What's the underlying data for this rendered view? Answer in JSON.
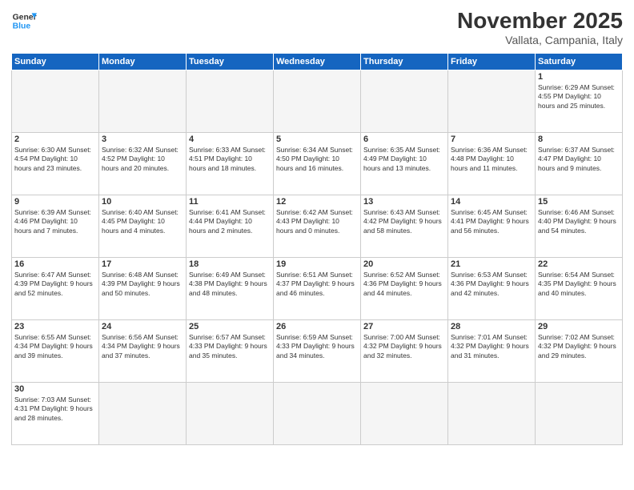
{
  "header": {
    "logo_general": "General",
    "logo_blue": "Blue",
    "month_title": "November 2025",
    "subtitle": "Vallata, Campania, Italy"
  },
  "days_of_week": [
    "Sunday",
    "Monday",
    "Tuesday",
    "Wednesday",
    "Thursday",
    "Friday",
    "Saturday"
  ],
  "weeks": [
    [
      {
        "num": "",
        "info": ""
      },
      {
        "num": "",
        "info": ""
      },
      {
        "num": "",
        "info": ""
      },
      {
        "num": "",
        "info": ""
      },
      {
        "num": "",
        "info": ""
      },
      {
        "num": "",
        "info": ""
      },
      {
        "num": "1",
        "info": "Sunrise: 6:29 AM\nSunset: 4:55 PM\nDaylight: 10 hours and 25 minutes."
      }
    ],
    [
      {
        "num": "2",
        "info": "Sunrise: 6:30 AM\nSunset: 4:54 PM\nDaylight: 10 hours and 23 minutes."
      },
      {
        "num": "3",
        "info": "Sunrise: 6:32 AM\nSunset: 4:52 PM\nDaylight: 10 hours and 20 minutes."
      },
      {
        "num": "4",
        "info": "Sunrise: 6:33 AM\nSunset: 4:51 PM\nDaylight: 10 hours and 18 minutes."
      },
      {
        "num": "5",
        "info": "Sunrise: 6:34 AM\nSunset: 4:50 PM\nDaylight: 10 hours and 16 minutes."
      },
      {
        "num": "6",
        "info": "Sunrise: 6:35 AM\nSunset: 4:49 PM\nDaylight: 10 hours and 13 minutes."
      },
      {
        "num": "7",
        "info": "Sunrise: 6:36 AM\nSunset: 4:48 PM\nDaylight: 10 hours and 11 minutes."
      },
      {
        "num": "8",
        "info": "Sunrise: 6:37 AM\nSunset: 4:47 PM\nDaylight: 10 hours and 9 minutes."
      }
    ],
    [
      {
        "num": "9",
        "info": "Sunrise: 6:39 AM\nSunset: 4:46 PM\nDaylight: 10 hours and 7 minutes."
      },
      {
        "num": "10",
        "info": "Sunrise: 6:40 AM\nSunset: 4:45 PM\nDaylight: 10 hours and 4 minutes."
      },
      {
        "num": "11",
        "info": "Sunrise: 6:41 AM\nSunset: 4:44 PM\nDaylight: 10 hours and 2 minutes."
      },
      {
        "num": "12",
        "info": "Sunrise: 6:42 AM\nSunset: 4:43 PM\nDaylight: 10 hours and 0 minutes."
      },
      {
        "num": "13",
        "info": "Sunrise: 6:43 AM\nSunset: 4:42 PM\nDaylight: 9 hours and 58 minutes."
      },
      {
        "num": "14",
        "info": "Sunrise: 6:45 AM\nSunset: 4:41 PM\nDaylight: 9 hours and 56 minutes."
      },
      {
        "num": "15",
        "info": "Sunrise: 6:46 AM\nSunset: 4:40 PM\nDaylight: 9 hours and 54 minutes."
      }
    ],
    [
      {
        "num": "16",
        "info": "Sunrise: 6:47 AM\nSunset: 4:39 PM\nDaylight: 9 hours and 52 minutes."
      },
      {
        "num": "17",
        "info": "Sunrise: 6:48 AM\nSunset: 4:39 PM\nDaylight: 9 hours and 50 minutes."
      },
      {
        "num": "18",
        "info": "Sunrise: 6:49 AM\nSunset: 4:38 PM\nDaylight: 9 hours and 48 minutes."
      },
      {
        "num": "19",
        "info": "Sunrise: 6:51 AM\nSunset: 4:37 PM\nDaylight: 9 hours and 46 minutes."
      },
      {
        "num": "20",
        "info": "Sunrise: 6:52 AM\nSunset: 4:36 PM\nDaylight: 9 hours and 44 minutes."
      },
      {
        "num": "21",
        "info": "Sunrise: 6:53 AM\nSunset: 4:36 PM\nDaylight: 9 hours and 42 minutes."
      },
      {
        "num": "22",
        "info": "Sunrise: 6:54 AM\nSunset: 4:35 PM\nDaylight: 9 hours and 40 minutes."
      }
    ],
    [
      {
        "num": "23",
        "info": "Sunrise: 6:55 AM\nSunset: 4:34 PM\nDaylight: 9 hours and 39 minutes."
      },
      {
        "num": "24",
        "info": "Sunrise: 6:56 AM\nSunset: 4:34 PM\nDaylight: 9 hours and 37 minutes."
      },
      {
        "num": "25",
        "info": "Sunrise: 6:57 AM\nSunset: 4:33 PM\nDaylight: 9 hours and 35 minutes."
      },
      {
        "num": "26",
        "info": "Sunrise: 6:59 AM\nSunset: 4:33 PM\nDaylight: 9 hours and 34 minutes."
      },
      {
        "num": "27",
        "info": "Sunrise: 7:00 AM\nSunset: 4:32 PM\nDaylight: 9 hours and 32 minutes."
      },
      {
        "num": "28",
        "info": "Sunrise: 7:01 AM\nSunset: 4:32 PM\nDaylight: 9 hours and 31 minutes."
      },
      {
        "num": "29",
        "info": "Sunrise: 7:02 AM\nSunset: 4:32 PM\nDaylight: 9 hours and 29 minutes."
      }
    ],
    [
      {
        "num": "30",
        "info": "Sunrise: 7:03 AM\nSunset: 4:31 PM\nDaylight: 9 hours and 28 minutes."
      },
      {
        "num": "",
        "info": ""
      },
      {
        "num": "",
        "info": ""
      },
      {
        "num": "",
        "info": ""
      },
      {
        "num": "",
        "info": ""
      },
      {
        "num": "",
        "info": ""
      },
      {
        "num": "",
        "info": ""
      }
    ]
  ]
}
